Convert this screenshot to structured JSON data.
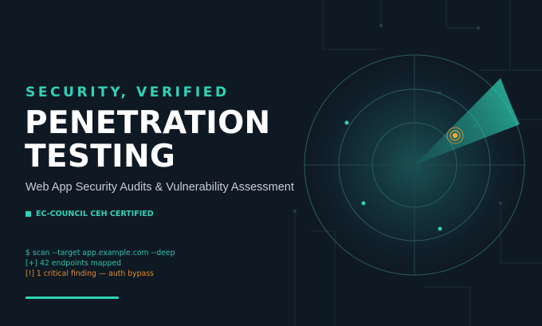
{
  "hero": {
    "eyebrow": "SECURITY, VERIFIED",
    "title_line1": "PENETRATION",
    "title_line2": "TESTING",
    "subtitle": "Web App Security Audits & Vulnerability Assessment",
    "badge": "EC-COUNCIL CEH CERTIFIED"
  },
  "terminal": {
    "line1": "$ scan --target app.example.com --deep",
    "line2": "[+] 42 endpoints mapped",
    "line3": "[!] 1 critical finding — auth bypass"
  },
  "colors": {
    "accent": "#2fd3b6",
    "warning": "#e08a32",
    "background": "#0f1924",
    "target": "#f2a52b"
  },
  "icons": {
    "badge_marker": "square-icon",
    "radar": "radar-icon",
    "target": "target-blip-icon"
  }
}
